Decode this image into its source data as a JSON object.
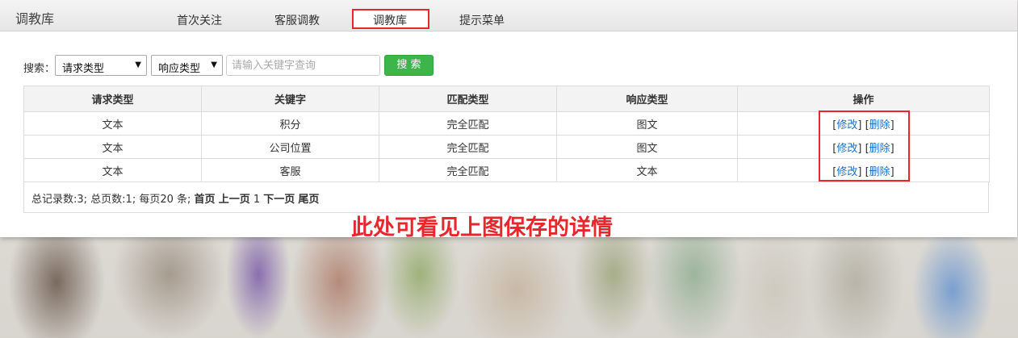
{
  "app_title": "调教库",
  "tabs": [
    {
      "label": "首次关注"
    },
    {
      "label": "客服调教"
    },
    {
      "label": "调教库"
    },
    {
      "label": "提示菜单"
    }
  ],
  "search": {
    "label": "搜索：",
    "request_type": "请求类型",
    "response_type": "响应类型",
    "keyword_placeholder": "请输入关键字查询",
    "button_label": "搜 索"
  },
  "table": {
    "headers": [
      "请求类型",
      "关键字",
      "匹配类型",
      "响应类型",
      "操作"
    ],
    "rows": [
      {
        "request_type": "文本",
        "keyword": "积分",
        "match_type": "完全匹配",
        "response_type": "图文",
        "edit": "修改",
        "delete": "删除"
      },
      {
        "request_type": "文本",
        "keyword": "公司位置",
        "match_type": "完全匹配",
        "response_type": "图文",
        "edit": "修改",
        "delete": "删除"
      },
      {
        "request_type": "文本",
        "keyword": "客服",
        "match_type": "完全匹配",
        "response_type": "文本",
        "edit": "修改",
        "delete": "删除"
      }
    ]
  },
  "pager": {
    "summary": "总记录数:3; 总页数:1; 每页20 条;",
    "first": "首页",
    "prev": "上一页",
    "current": "1",
    "next": "下一页",
    "last": "尾页"
  },
  "annotation": "此处可看见上图保存的详情",
  "colors": {
    "highlight": "#e8262b",
    "search_button": "#3cb64a",
    "link": "#1a6fc7"
  }
}
